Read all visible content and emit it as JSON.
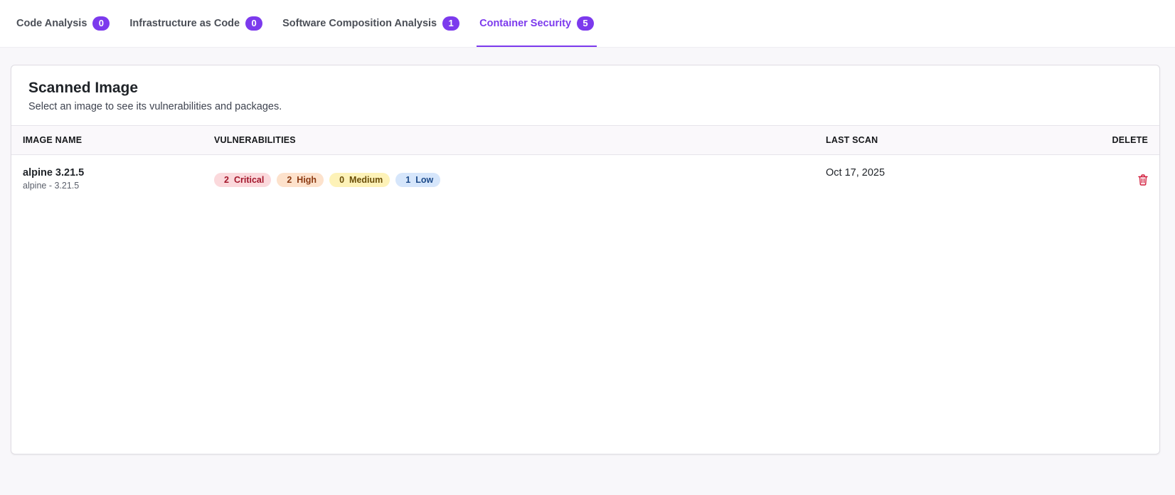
{
  "tabs": [
    {
      "label": "Code Analysis",
      "count": "0"
    },
    {
      "label": "Infrastructure as Code",
      "count": "0"
    },
    {
      "label": "Software Composition Analysis",
      "count": "1"
    },
    {
      "label": "Container Security",
      "count": "5"
    }
  ],
  "active_tab": "Container Security",
  "card": {
    "title": "Scanned Image",
    "subtitle": "Select an image to see its vulnerabilities and packages."
  },
  "table": {
    "headers": {
      "image_name": "IMAGE NAME",
      "vulnerabilities": "VULNERABILITIES",
      "last_scan": "LAST SCAN",
      "delete": "DELETE"
    },
    "rows": [
      {
        "name": "alpine 3.21.5",
        "subname": "alpine - 3.21.5",
        "vulnerabilities": {
          "critical": {
            "count": "2",
            "label": "Critical"
          },
          "high": {
            "count": "2",
            "label": "High"
          },
          "medium": {
            "count": "0",
            "label": "Medium"
          },
          "low": {
            "count": "1",
            "label": "Low"
          }
        },
        "last_scan": "Oct 17, 2025",
        "delete_icon": "trash-icon"
      }
    ]
  },
  "colors": {
    "accent": "#7c3aed",
    "critical": "#a3162b",
    "high": "#8c3a12",
    "medium": "#6b4e08",
    "low": "#1c4a8a",
    "delete": "#d11a3a"
  }
}
